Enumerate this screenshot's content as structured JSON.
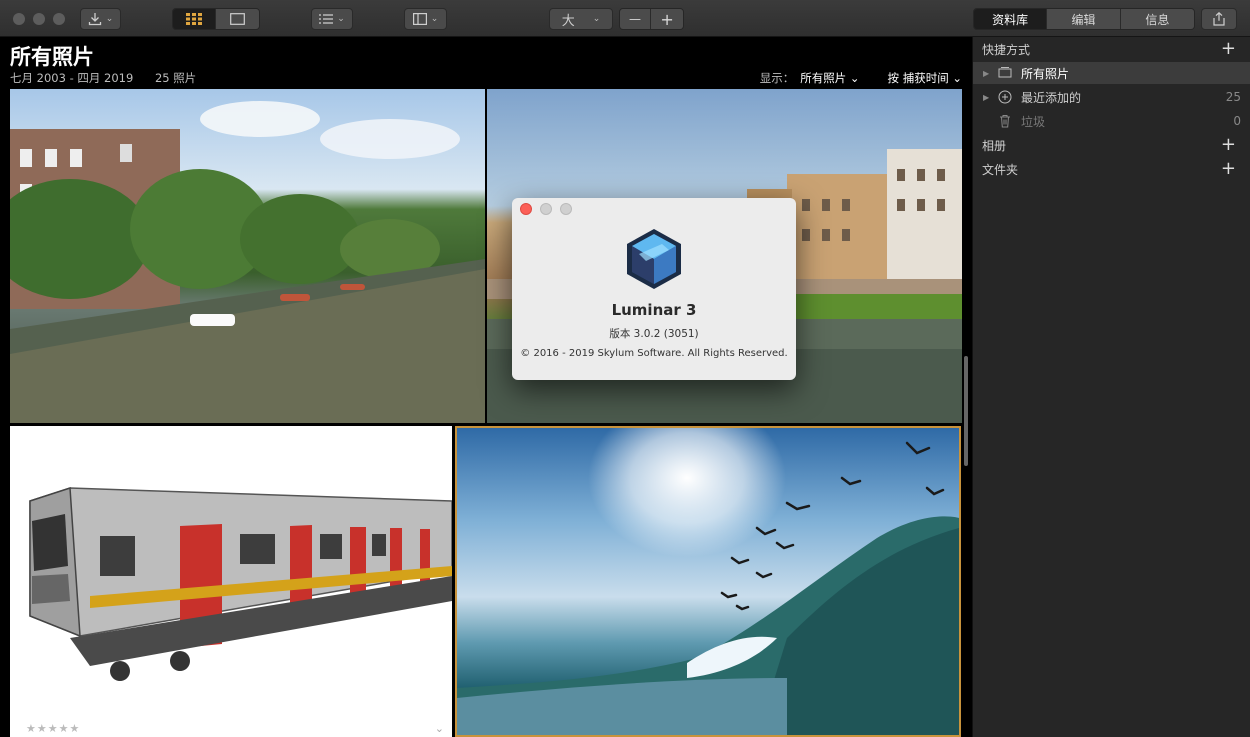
{
  "toolbar": {
    "size_label": "大",
    "zoom_out_label": "—",
    "zoom_in_label": "+",
    "tabs": [
      {
        "label": "资料库",
        "active": true
      },
      {
        "label": "编辑",
        "active": false
      },
      {
        "label": "信息",
        "active": false
      }
    ]
  },
  "main": {
    "title": "所有照片",
    "date_range": "七月 2003 - 四月 2019",
    "photo_count": "25 照片",
    "show_label": "显示：",
    "show_value": "所有照片",
    "sort_label": "按 捕获时间",
    "stars": "★★★★★",
    "selected_color": "#c8933c"
  },
  "sidebar": {
    "shortcuts_title": "快捷方式",
    "items": [
      {
        "label": "所有照片",
        "count": "",
        "selected": true
      },
      {
        "label": "最近添加的",
        "count": "25",
        "selected": false
      },
      {
        "label": "垃圾",
        "count": "0",
        "selected": false
      }
    ],
    "albums_title": "相册",
    "folders_title": "文件夹"
  },
  "dialog": {
    "app_name": "Luminar 3",
    "version": "版本 3.0.2 (3051)",
    "copyright": "© 2016 - 2019 Skylum Software. All Rights Reserved."
  }
}
